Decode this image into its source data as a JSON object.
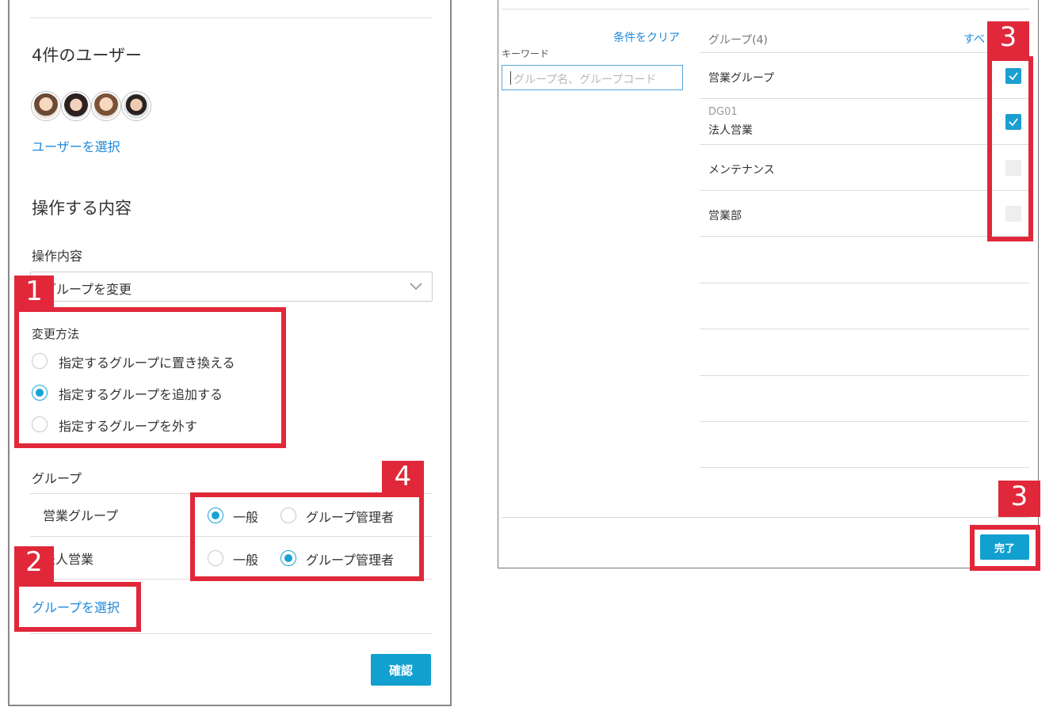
{
  "left": {
    "user_count_title": "4件のユーザー",
    "select_users_link": "ユーザーを選択",
    "operation_section_title": "操作する内容",
    "operation_label": "操作内容",
    "operation_value": "グループを変更",
    "change_method_label": "変更方法",
    "change_methods": [
      {
        "label": "指定するグループに置き換える",
        "selected": false
      },
      {
        "label": "指定するグループを追加する",
        "selected": true
      },
      {
        "label": "指定するグループを外す",
        "selected": false
      }
    ],
    "group_label": "グループ",
    "groups": [
      {
        "name": "営業グループ",
        "role": "一般"
      },
      {
        "name": "法人営業",
        "role": "グループ管理者"
      }
    ],
    "role_options": [
      "一般",
      "グループ管理者"
    ],
    "select_group_link": "グループを選択",
    "confirm_button": "確認"
  },
  "right": {
    "clear_link": "条件をクリア",
    "keyword_label": "キーワード",
    "keyword_placeholder": "グループ名、グループコード",
    "groups_header": "グループ(4)",
    "select_all_link": "すべ",
    "rows": [
      {
        "code": "",
        "name": "営業グループ",
        "checked": true
      },
      {
        "code": "DG01",
        "name": "法人営業",
        "checked": true
      },
      {
        "code": "",
        "name": "メンテナンス",
        "checked": false
      },
      {
        "code": "",
        "name": "営業部",
        "checked": false
      }
    ],
    "done_button": "完了"
  },
  "annotations": [
    "1",
    "2",
    "3",
    "4"
  ],
  "colors": {
    "accent": "#12a0d0",
    "link": "#1e88d9",
    "annotation": "#e0283a"
  }
}
